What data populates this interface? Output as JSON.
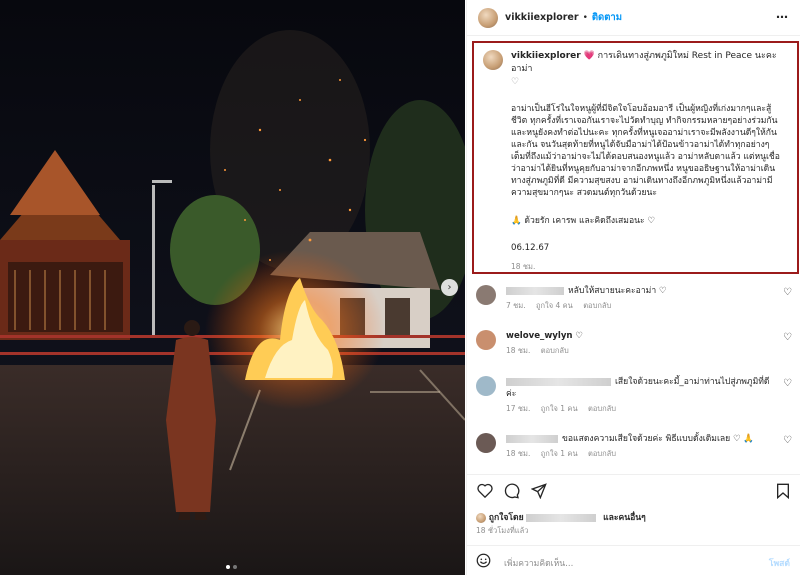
{
  "post": {
    "username": "vikkiiexplorer",
    "separator": "•",
    "follow_label": "ติดตาม",
    "more_label": "⋯"
  },
  "caption": {
    "username": "vikkiiexplorer",
    "heart": "💗",
    "title_text": "การเดินทางสู่ภพภูมิใหม่ Rest in Peace นะคะอาม่า",
    "title_heart": "♡",
    "body": "อาม่าเป็นฮีโร่ในใจหนูผู้ที่มีจิตใจโอบอ้อมอารี เป็นผู้หญิงที่เก่งมากๆและสู้ชีวิต ทุกครั้งที่เราเจอกันเราจะไปวัดทำบุญ ทำกิจกรรมหลายๆอย่างร่วมกันและหนูยังคงทำต่อไปนะคะ ทุกครั้งที่หนูเจออาม่าเราจะมีพลังงานดีๆให้กันและกัน จนวันสุดท้ายที่หนูได้จับมือาม่าได้ป้อนข้าวอาม่าได้ทำทุกอย่างๆเต็มที่ถึงแม้ว่าอาม่าจะไม่ได้ตอบสนองหนูแล้ว อาม่าหลับตาแล้ว แต่หนูเชื่อว่าอาม่าได้ยินที่หนูคุยกับอาม่าจากอีกภพหนึ่ง หนูขออธิษฐานให้อาม่าเดินทางสู่ภพภูมิที่ดี มีความสุขสงบ อาม่าเดินทางถึงอีกภพภูมิหนึ่งแล้วอาม่ามีความสุขมากๆนะ สวดมนต์ทุกวันด้วยนะ",
    "sign": "🙏 ด้วยรัก เคารพ และคิดถึงเสมอนะ ♡",
    "date": "06.12.67",
    "time": "18 ชม."
  },
  "comments": [
    {
      "name_hidden": true,
      "text": "หลับให้สบายนะคะอาม่า ♡",
      "time": "7 ชม.",
      "likes": "ถูกใจ 4 คน",
      "reply": "ตอบกลับ",
      "avatar_color": "#8a7a72"
    },
    {
      "name": "welove_wylyn",
      "text": "♡",
      "time": "18 ชม.",
      "reply": "ตอบกลับ",
      "avatar_color": "#c98f6e"
    },
    {
      "name_hidden": true,
      "text": "เสียใจด้วยนะคะมี้_อาม่าท่านไปสู่ภพภูมิที่ดีค่ะ",
      "time": "17 ชม.",
      "likes": "ถูกใจ 1 คน",
      "reply": "ตอบกลับ",
      "avatar_color": "#9fb9c9"
    },
    {
      "name_hidden": true,
      "text": "ขอแสดงความเสียใจด้วยค่ะ พิธีแบบดั้งเดิมเลย ♡ 🙏",
      "time": "18 ชม.",
      "likes": "ถูกใจ 1 คน",
      "reply": "ตอบกลับ",
      "avatar_color": "#6b5a55"
    }
  ],
  "footer": {
    "liked_by_prefix": "ถูกใจโดย",
    "liked_by_suffix": "และคนอื่นๆ",
    "ago": "18 ชั่วโมงที่แล้ว",
    "comment_placeholder": "เพิ่มความคิดเห็น...",
    "post_label": "โพสต์"
  },
  "icons": {
    "heart": "heart-icon",
    "comment": "comment-icon",
    "share": "share-icon",
    "save": "bookmark-icon",
    "emoji": "emoji-icon",
    "next": "chevron-right-icon"
  },
  "colors": {
    "accent": "#0095f6",
    "highlight_border": "#9b1b1b",
    "muted": "#8e8e8e"
  }
}
